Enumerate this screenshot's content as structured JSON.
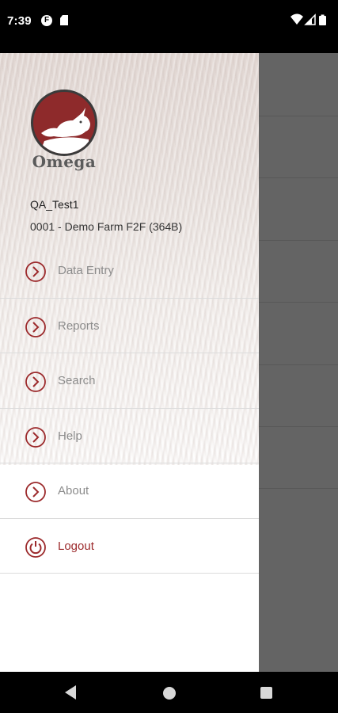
{
  "status_bar": {
    "time": "7:39",
    "icons": [
      "f-app-icon",
      "sd-card-icon",
      "wifi-icon",
      "cell-signal-icon",
      "battery-icon"
    ]
  },
  "drawer": {
    "logo_text": "Omega",
    "user_name": "QA_Test1",
    "farm_name": "0001 - Demo Farm F2F (364B)",
    "menu": [
      {
        "label": "Data Entry",
        "icon": "chevron-right-circle-icon"
      },
      {
        "label": "Reports",
        "icon": "chevron-right-circle-icon"
      },
      {
        "label": "Search",
        "icon": "chevron-right-circle-icon"
      },
      {
        "label": "Help",
        "icon": "chevron-right-circle-icon"
      },
      {
        "label": "About",
        "icon": "chevron-right-circle-icon"
      },
      {
        "label": "Logout",
        "icon": "power-icon"
      }
    ]
  },
  "nav_bar": {
    "icons": [
      "back-icon",
      "home-icon",
      "recent-apps-icon"
    ]
  },
  "colors": {
    "accent": "#9c2a2c",
    "menu_text": "#8c8c8c",
    "scrim": "#646464"
  }
}
